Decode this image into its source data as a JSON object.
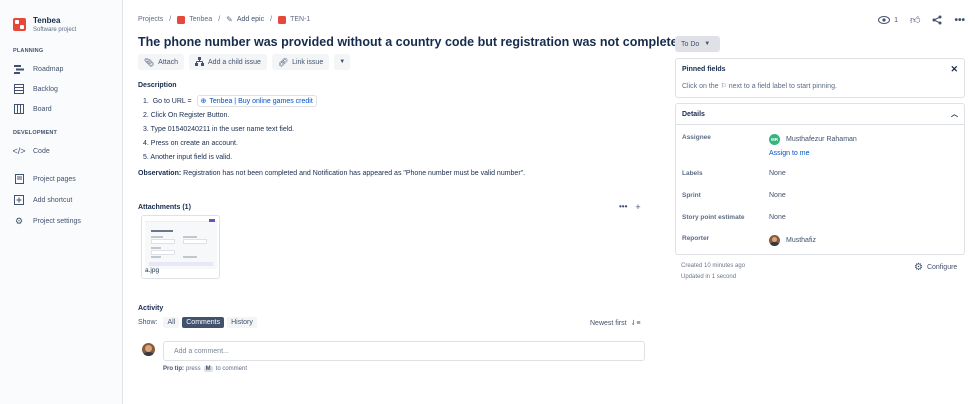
{
  "sidebar": {
    "project_name": "Tenbea",
    "project_type": "Software project",
    "planning_title": "PLANNING",
    "development_title": "DEVELOPMENT",
    "items": {
      "roadmap": "Roadmap",
      "backlog": "Backlog",
      "board": "Board",
      "code": "Code",
      "project_pages": "Project pages",
      "add_shortcut": "Add shortcut",
      "project_settings": "Project settings"
    }
  },
  "breadcrumb": {
    "projects": "Projects",
    "project": "Tenbea",
    "add_epic": "Add epic",
    "issue_key": "TEN-1"
  },
  "top_actions": {
    "watchers": "1"
  },
  "issue": {
    "title": "The phone number was provided without a country code but registration was not completed.",
    "toolbar": {
      "attach": "Attach",
      "add_child": "Add a child issue",
      "link_issue": "Link issue"
    },
    "description_heading": "Description",
    "steps": {
      "s1_prefix": "1.  Go to URL = ",
      "s1_link": "Tenbea | Buy online games credit",
      "s2": "2.  Click On Register Button.",
      "s3": "3.  Type 01540240211 in the user name text field.",
      "s4": "4.  Press on create an account.",
      "s5": "5.  Another input field is valid."
    },
    "observation_label": "Observation:",
    "observation_text": " Registration has not been completed and Notification has appeared as \"Phone number must be valid number\"."
  },
  "attachments": {
    "heading": "Attachments (1)",
    "file_name": "a.jpg"
  },
  "activity": {
    "heading": "Activity",
    "show_label": "Show:",
    "filters": {
      "all": "All",
      "comments": "Comments",
      "history": "History"
    },
    "sort": "Newest first",
    "comment_placeholder": "Add a comment...",
    "protip_label": "Pro tip:",
    "protip_press": "press",
    "protip_key": "M",
    "protip_rest": "to comment"
  },
  "status": {
    "label": "To Do"
  },
  "pinned": {
    "heading": "Pinned fields",
    "text": "Click on the ⚐ next to a field label to start pinning."
  },
  "details": {
    "heading": "Details",
    "assignee_label": "Assignee",
    "assignee_initials": "MR",
    "assignee_name": "Musthafezur Rahaman",
    "assign_to_me": "Assign to me",
    "labels_label": "Labels",
    "labels_value": "None",
    "sprint_label": "Sprint",
    "sprint_value": "None",
    "story_points_label": "Story point estimate",
    "story_points_value": "None",
    "reporter_label": "Reporter",
    "reporter_name": "Musthafiz"
  },
  "meta": {
    "created": "Created 10 minutes ago",
    "updated": "Updated in 1 second",
    "configure": "Configure"
  },
  "colors": {
    "brand_red": "#e5493a",
    "link_blue": "#0052cc",
    "active_filter": "#42526e",
    "assignee_avatar": "#36b37e"
  }
}
